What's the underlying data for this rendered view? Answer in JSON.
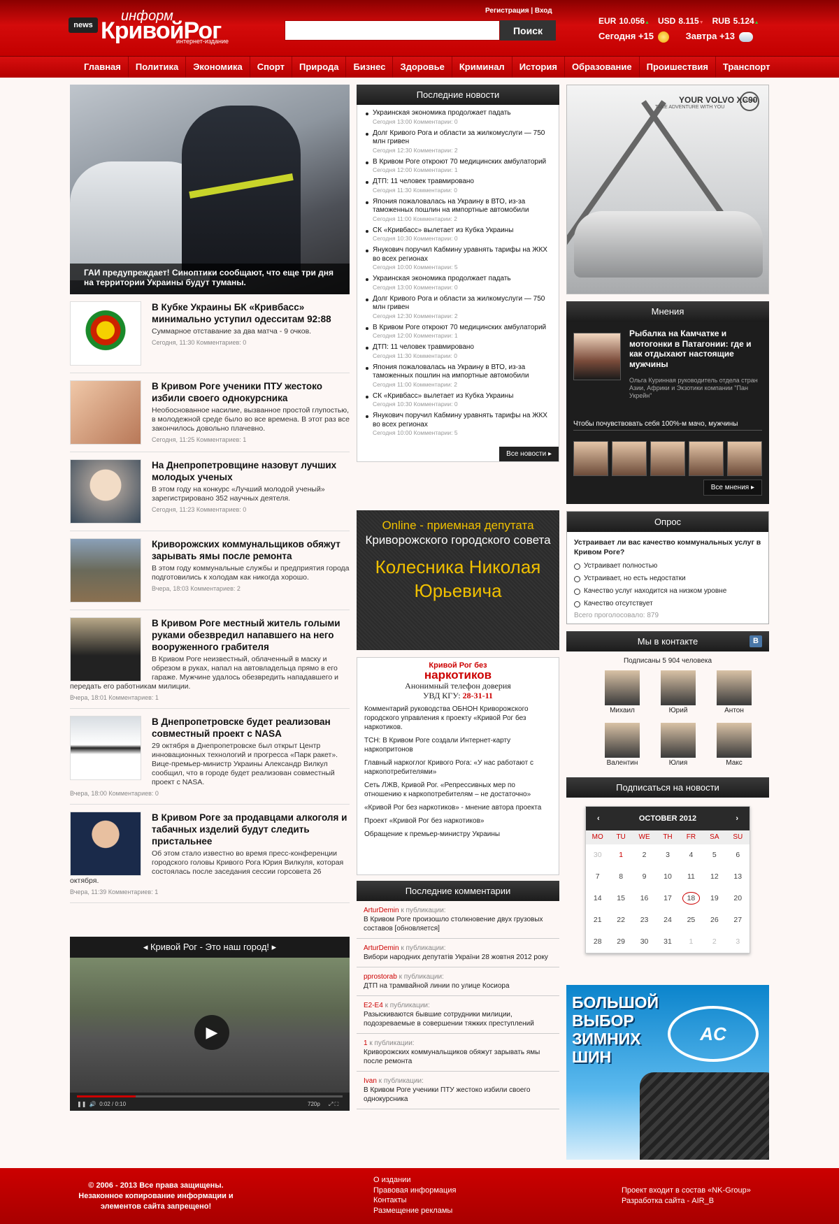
{
  "header": {
    "logo": {
      "news": "news",
      "inform": "информ",
      "main": "КривойРог",
      "sub": "интернет-издание"
    },
    "auth": "Регистрация | Вход",
    "search": {
      "placeholder": "",
      "button": "Поиск"
    },
    "currency": [
      {
        "code": "EUR",
        "value": "10.056",
        "trend": "up"
      },
      {
        "code": "USD",
        "value": "8.115",
        "trend": "down"
      },
      {
        "code": "RUB",
        "value": "5.124",
        "trend": "up"
      }
    ],
    "weather": {
      "today": "Сегодня +15",
      "tomorrow": "Завтра +13"
    },
    "colors": {
      "brand": "#c80000",
      "nav_bg": "#b80000",
      "dark": "#1f1f1f",
      "accent_yellow": "#f0c000"
    }
  },
  "nav": [
    "Главная",
    "Политика",
    "Экономика",
    "Спорт",
    "Природа",
    "Бизнес",
    "Здоровье",
    "Криминал",
    "История",
    "Образование",
    "Проишествия",
    "Транспорт"
  ],
  "hero": {
    "caption": "ГАИ предупреждает! Синоптики сообщают, что еще три дня на территории Украины будут туманы."
  },
  "articles": [
    {
      "title": "В Кубке Украины БК «Кривбасс» минимально уступил одесситам 92:88",
      "text": "Суммарное отставание за два матча - 9 очков.",
      "meta": "Сегодня, 11:30 Комментариев: 0"
    },
    {
      "title": "В Кривом Роге ученики ПТУ жестоко избили своего однокурсника",
      "text": "Необоснованное насилие, вызванное простой глупостью, в молодежной среде было во все времена. В этот раз все закончилось довольно плачевно.",
      "meta": "Сегодня, 11:25 Комментариев: 1"
    },
    {
      "title": "На Днепропетровщине назовут лучших молодых ученых",
      "text": "В этом году на конкурс «Лучший молодой ученый» зарегистрировано 352 научных деятеля.",
      "meta": "Сегодня, 11:23 Комментариев: 0"
    },
    {
      "title": "Криворожских коммунальщиков обяжут зарывать ямы после ремонта",
      "text": "В этом году коммунальные службы и предприятия города подготовились к холодам как никогда хорошо.",
      "meta": "Вчера, 18:03 Комментариев: 2"
    },
    {
      "title": "В Кривом Роге местный житель голыми руками обезвредил напавшего на него вооруженного грабителя",
      "text": "В Кривом Роге неизвестный, облаченный в маску и обрезом в руках, напал на автовладельца прямо в его гараже. Мужчине удалось обезвредить нападавшего и передать его работникам милиции.",
      "meta": "Вчера, 18:01 Комментариев: 1"
    },
    {
      "title": "В Днепропетровске будет реализован совместный проект с NASA",
      "text": "29 октября в Днепропетровске был открыт Центр инновационных технологий и прогресса «Парк ракет». Вице-премьер-министр Украины Александр Вилкул сообщил, что в городе будет реализован совместный проект с NASA.",
      "meta": "Вчера, 18:00 Комментариев: 0"
    },
    {
      "title": "В Кривом Роге за продавцами алкоголя и табачных изделий будут следить пристальнее",
      "text": "Об этом стало известно во время пресс-конференции городского головы Кривого Рога Юрия Вилкуля, которая состоялась после заседания сессии горсовета 26 октября.",
      "meta": "Вчера, 11:39 Комментариев: 1"
    }
  ],
  "video": {
    "title": "◂ Кривой Рог - Это наш город! ▸",
    "time": "0:02 / 0:10",
    "quality": "720p",
    "progress": 0.22
  },
  "latest": {
    "title": "Последние новости",
    "items": [
      {
        "t": "Украинская экономика продолжает падать",
        "m": "Сегодня 13:00  Комментарии: 0"
      },
      {
        "t": "Долг Кривого Рога и области за жилкомуслуги — 750 млн гривен",
        "m": "Сегодня 12:30  Комментарии: 2"
      },
      {
        "t": "В Кривом Роге откроют 70 медицинских амбулаторий",
        "m": "Сегодня 12:00  Комментарии: 1"
      },
      {
        "t": "ДТП: 11 человек травмировано",
        "m": "Сегодня 11:30  Комментарии: 0"
      },
      {
        "t": "Япония пожаловалась на Украину в ВТО, из-за таможенных пошлин на импортные автомобили",
        "m": "Сегодня 11:00  Комментарии: 2"
      },
      {
        "t": "СК «Кривбасс» вылетает из Кубка Украины",
        "m": "Сегодня 10:30  Комментарии: 0"
      },
      {
        "t": "Янукович поручил Кабмину уравнять тарифы на ЖКХ во всех регионах",
        "m": "Сегодня 10:00  Комментарии: 5"
      },
      {
        "t": "Украинская экономика продолжает падать",
        "m": "Сегодня 13:00  Комментарии: 0"
      },
      {
        "t": "Долг Кривого Рога и области за жилкомуслуги — 750 млн гривен",
        "m": "Сегодня 12:30  Комментарии: 2"
      },
      {
        "t": "В Кривом Роге откроют 70 медицинских амбулаторий",
        "m": "Сегодня 12:00  Комментарии: 1"
      },
      {
        "t": "ДТП: 11 человек травмировано",
        "m": "Сегодня 11:30  Комментарии: 0"
      },
      {
        "t": "Япония пожаловалась на Украину в ВТО, из-за таможенных пошлин на импортные автомобили",
        "m": "Сегодня 11:00  Комментарии: 2"
      },
      {
        "t": "СК «Кривбасс» вылетает из Кубка Украины",
        "m": "Сегодня 10:30  Комментарии: 0"
      },
      {
        "t": "Янукович поручил Кабмину уравнять тарифы на ЖКХ во всех регионах",
        "m": "Сегодня 10:00  Комментарии: 5"
      }
    ],
    "all": "Все новости ▸"
  },
  "deputy": {
    "online": "Online - приемная депутата",
    "body": "Криворожского городского совета",
    "name": "Колесника Николая Юрьевича"
  },
  "drugs": {
    "l1": "Кривой Рог без",
    "l2": "наркотиков",
    "l3": "Анонимный телефон доверия",
    "l4": "УВД КГУ:",
    "phone": "28-31-11",
    "links": [
      "Комментарий руководства ОБНОН Криворожского городского управления к проекту «Кривой Рог без наркотиков.",
      "ТСН: В Кривом Роге создали Интернет-карту наркопритонов",
      "Главный наркоглог Кривого Рога: «У нас работают с наркопотребителями»",
      "Сеть ЛЖВ, Кривой Рог. «Репрессивных мер по отношению к наркопотребителям – не достаточно»",
      "«Кривой Рог без наркотиков» - мнение автора проекта",
      "Проект «Кривой Рог без наркотиков»",
      "Обращение к премьер-министру Украины"
    ]
  },
  "comments": {
    "title": "Последние комментарии",
    "items": [
      {
        "u": "ArturDemin",
        "k": " к публикации:",
        "t": "В Кривом Роге произошло столкновение двух грузовых составов [обновляется]"
      },
      {
        "u": "ArturDemin",
        "k": " к публикации:",
        "t": "Вибори народних депутатів України 28 жовтня 2012 року"
      },
      {
        "u": "pprostorab",
        "k": " к публикации:",
        "t": "ДТП на трамвайной линии по улице Косиора"
      },
      {
        "u": "E2-E4",
        "k": " к публикации:",
        "t": "Разыскиваются бывшие сотрудники милиции, подозреваемые в совершении тяжких преступлений"
      },
      {
        "u": "1",
        "k": " к публикации:",
        "t": "Криворожских коммунальщиков обяжут зарывать ямы после ремонта"
      },
      {
        "u": "Ivan",
        "k": " к публикации:",
        "t": "В Кривом Роге ученики ПТУ жестоко избили своего однокурсника"
      }
    ]
  },
  "volvo": {
    "title": "YOUR VOLVO XC90",
    "sub": "TAKE ADVENTURE WITH YOU",
    "logo": "VOLVO"
  },
  "opinions": {
    "title": "Мнения",
    "headline": "Рыбалка на Камчатке и мотогонки в Патагонии: где и как отдыхают настоящие мужчины",
    "author": "Ольга Куринная руководитель отдела стран Азии, Африки и Экзотики компании \"Пан Укрейн\"",
    "quote": "Чтобы почувствовать себя 100%-м мачо, мужчины",
    "all": "Все мнения ▸"
  },
  "poll": {
    "title": "Опрос",
    "question": "Устраивает ли вас качество коммунальных услуг в Кривом Роге?",
    "options": [
      "Устраивает полностью",
      "Устраивает, но есть недостатки",
      "Качество услуг находится на низком уровне",
      "Качество отсутствует"
    ],
    "total": "Всего проголосовало: 879"
  },
  "vk": {
    "title": "Мы в контакте",
    "badge": "B",
    "count": "Подписаны 5 904 человека",
    "people": [
      "Михаил",
      "Юрий",
      "Антон",
      "Валентин",
      "Юлия",
      "Макс"
    ]
  },
  "subscribe": {
    "title": "Подписаться на новости"
  },
  "calendar": {
    "month": "OCTOBER 2012",
    "prev": "‹",
    "next": "›",
    "weekdays": [
      "MO",
      "TU",
      "WE",
      "TH",
      "FR",
      "SA",
      "SU"
    ],
    "days": [
      "30",
      "1",
      "2",
      "3",
      "4",
      "5",
      "6",
      "7",
      "8",
      "9",
      "10",
      "11",
      "12",
      "13",
      "14",
      "15",
      "16",
      "17",
      "18",
      "19",
      "20",
      "21",
      "22",
      "23",
      "24",
      "25",
      "26",
      "27",
      "28",
      "29",
      "30",
      "31",
      "1",
      "2",
      "3"
    ],
    "today": "18"
  },
  "tires": {
    "text": "БОЛЬШОЙ ВЫБОР ЗИМНИХ ШИН",
    "logo": "AC"
  },
  "footer": {
    "copy": "© 2006 - 2013 Все права защищены. Незаконное копирование информации и элементов сайта запрещено!",
    "links": [
      "О издании",
      "Правовая информация",
      "Контакты",
      "Размещение рекламы"
    ],
    "right": [
      "Проект входит в состав «NK-Group»",
      "Разработка сайта - AIR_B"
    ]
  }
}
